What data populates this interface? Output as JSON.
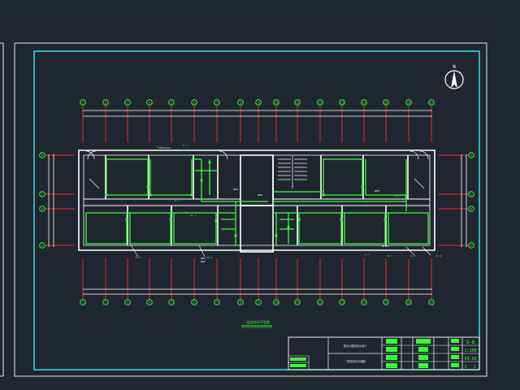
{
  "colors": {
    "background": "#202630",
    "sheet_border": "#e8e8e8",
    "drawing_frame": "#2ee6e6",
    "wall": "#ffffff",
    "axis_line": "#ff2a2a",
    "axis_bubble": "#33ff33",
    "pipe": "#33ff33",
    "title_block_text": "#33ff33"
  },
  "north_arrow": {
    "label": "N"
  },
  "drawing": {
    "title": "一层给排水平面图",
    "axis_labels_top": [
      "1",
      "2",
      "3",
      "4",
      "5",
      "6",
      "7",
      "8",
      "9",
      "10",
      "11",
      "12",
      "13",
      "14",
      "15",
      "16",
      "17"
    ],
    "axis_labels_bottom": [
      "1",
      "2",
      "3",
      "4",
      "5",
      "6",
      "7",
      "8",
      "9",
      "10",
      "11",
      "12",
      "13",
      "14",
      "15",
      "16",
      "17"
    ],
    "axis_labels_left": [
      "D",
      "C",
      "B",
      "A"
    ],
    "axis_labels_right": [
      "D",
      "C",
      "B",
      "A"
    ],
    "pipe_tags": [
      "JL-1",
      "JL-2",
      "JL-3",
      "WL-1",
      "WL-2",
      "WL-3",
      "JL-4",
      "WL-4",
      "JL-5",
      "WL-5",
      "JL-6",
      "WL-6"
    ],
    "notes": [
      "DN15",
      "DN20",
      "DN25",
      "DN32",
      "DN50",
      "DN100"
    ]
  },
  "title_block": {
    "project": "某办公楼给排水设计",
    "drawing_name": "一层给排水平面图",
    "sheet_code": "S-8",
    "scale": "1:100",
    "date": "04.09",
    "sheet_no": "1",
    "total": "1"
  }
}
